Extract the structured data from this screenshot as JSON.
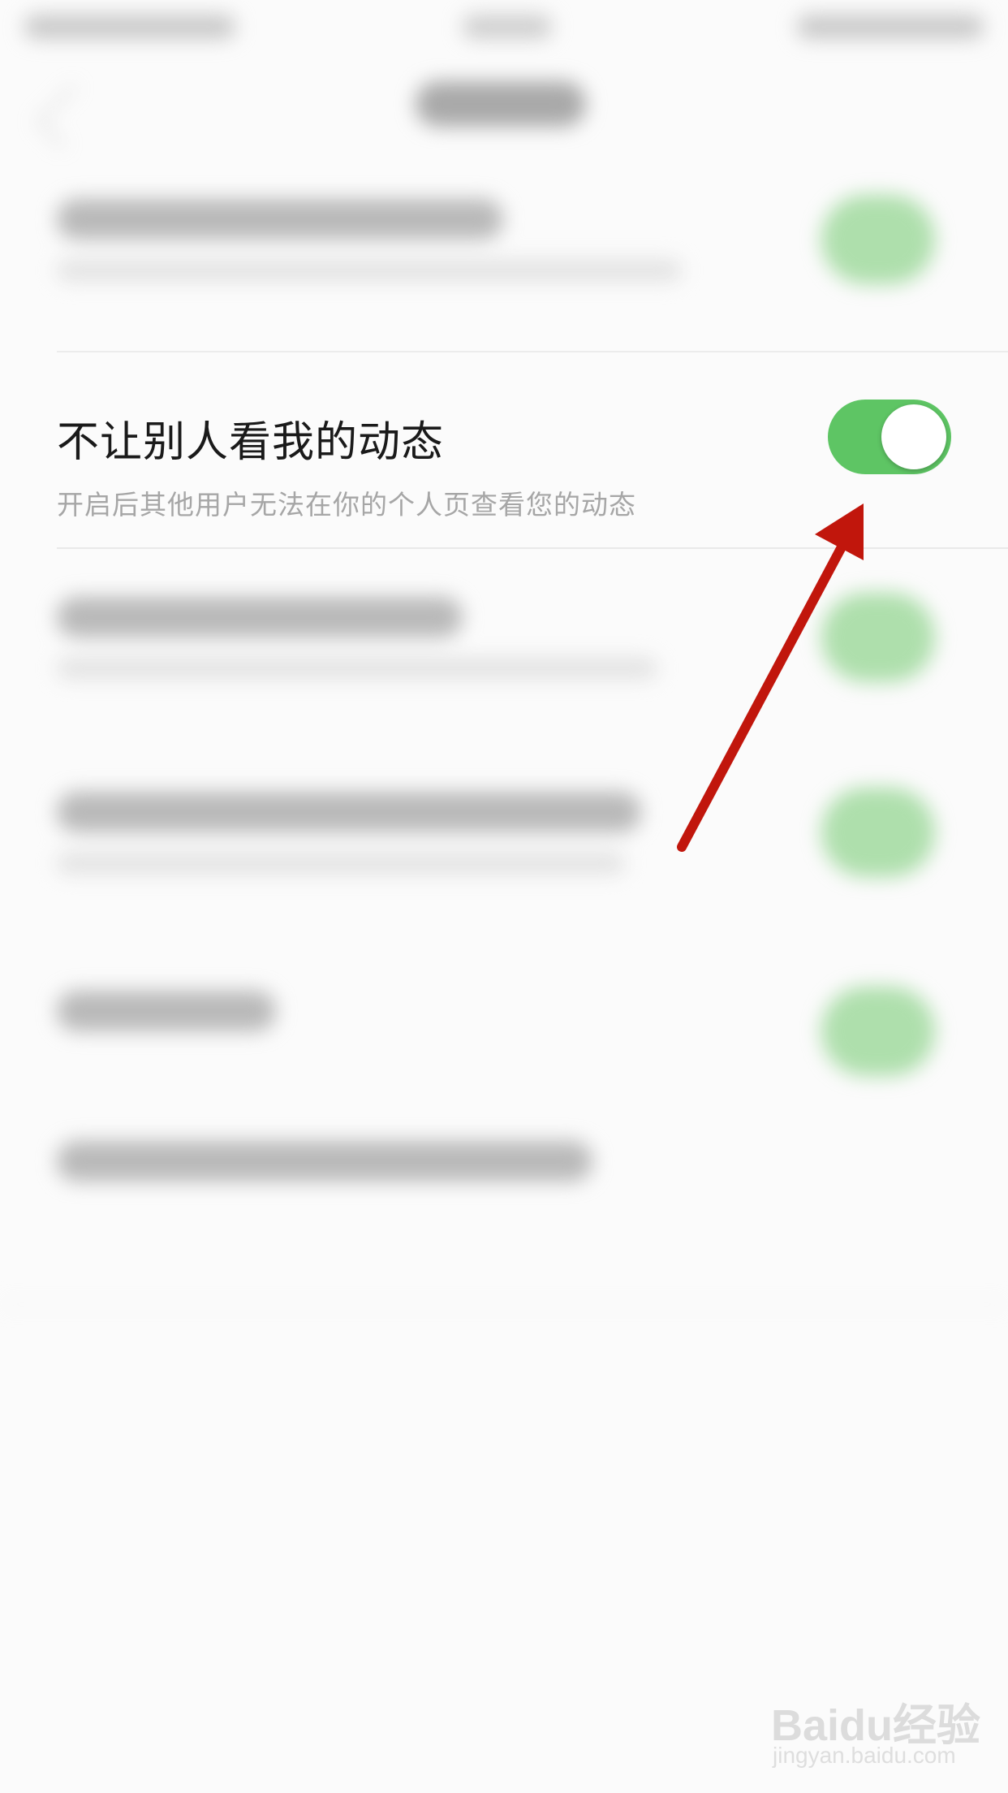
{
  "setting": {
    "title": "不让别人看我的动态",
    "subtitle": "开启后其他用户无法在你的个人页查看您的动态",
    "toggle_state": "on",
    "toggle_color": "#5ec564"
  },
  "annotation": {
    "arrow_color": "#c1160c"
  },
  "watermark": {
    "logo": "Baidu经验",
    "url": "jingyan.baidu.com"
  }
}
